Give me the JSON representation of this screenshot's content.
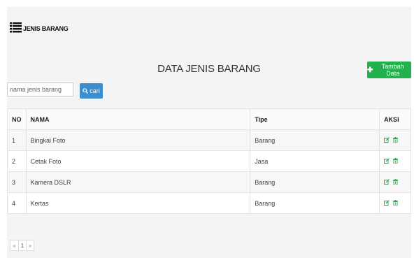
{
  "header": {
    "icon": "list-icon",
    "title": "JENIS BARANG"
  },
  "page_title": "DATA JENIS BARANG",
  "add_button": {
    "icon": "plus-icon",
    "label": "Tambah Data",
    "color": "#23b14d"
  },
  "search": {
    "placeholder": "nama jenis barang",
    "button_icon": "search-icon",
    "button_label": "cari",
    "button_color": "#3c8dce"
  },
  "table": {
    "headers": [
      "NO",
      "NAMA",
      "Tipe",
      "AKSI"
    ],
    "rows": [
      {
        "no": "1",
        "nama": "Bingkai Foto",
        "tipe": "Barang"
      },
      {
        "no": "2",
        "nama": "Cetak Foto",
        "tipe": "Jasa"
      },
      {
        "no": "3",
        "nama": "Kamera DSLR",
        "tipe": "Barang"
      },
      {
        "no": "4",
        "nama": "Kertas",
        "tipe": "Barang"
      }
    ],
    "action_icons": [
      "edit-icon",
      "trash-icon"
    ],
    "action_color": "#23b14d"
  },
  "pagination": {
    "prev": "«",
    "current": "1",
    "next": "»"
  }
}
